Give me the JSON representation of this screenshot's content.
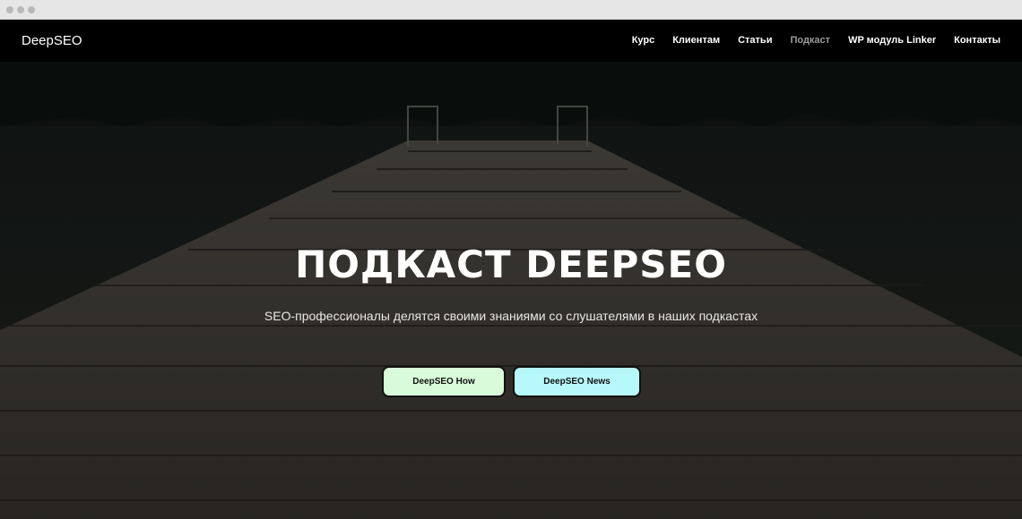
{
  "navbar": {
    "brand": "DeepSEO",
    "links": [
      {
        "label": "Курс"
      },
      {
        "label": "Клиентам"
      },
      {
        "label": "Статьи"
      },
      {
        "label": "Подкаст"
      },
      {
        "label": "WP модуль Linker"
      },
      {
        "label": "Контакты"
      }
    ]
  },
  "hero": {
    "title": "ПОДКАСТ DEEPSEO",
    "subtitle": "SEO-профессионалы делятся своими знаниями со слушателями в наших подкастах",
    "buttons": {
      "how": "DeepSEO How",
      "news": "DeepSEO News"
    }
  },
  "colors": {
    "navbar_bg": "#000000",
    "active_link": "#9b9b9b",
    "button_how_bg": "#d9fbd9",
    "button_news_bg": "#b7f8fb"
  }
}
